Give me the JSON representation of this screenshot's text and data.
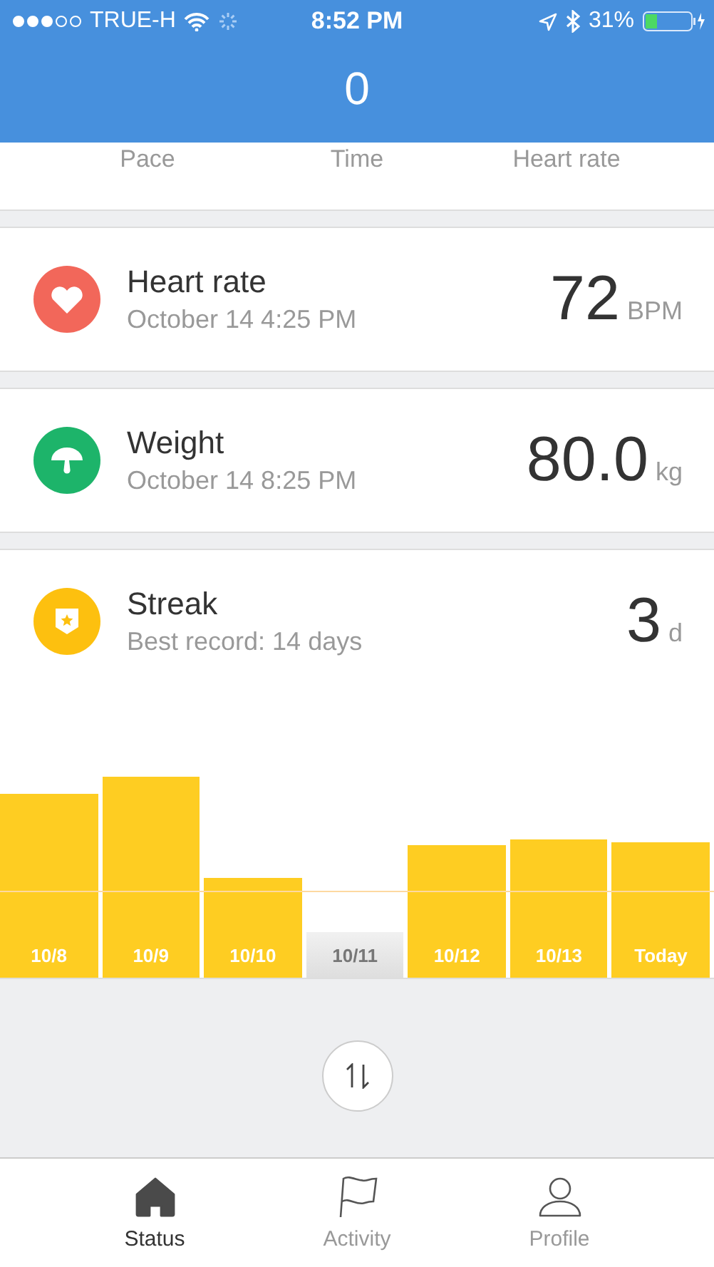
{
  "status_bar": {
    "carrier": "TRUE-H",
    "time": "8:52 PM",
    "battery": "31%"
  },
  "header": {
    "title": "0"
  },
  "summary_labels": [
    "Pace",
    "Time",
    "Heart rate"
  ],
  "cards": [
    {
      "kind": "heart",
      "title": "Heart rate",
      "subtitle": "October 14 4:25 PM",
      "value": "72",
      "unit": "BPM",
      "color": "#f2675a"
    },
    {
      "kind": "weight",
      "title": "Weight",
      "subtitle": "October 14 8:25 PM",
      "value": "80.0",
      "unit": "kg",
      "color": "#1db46a"
    },
    {
      "kind": "streak",
      "title": "Streak",
      "subtitle": "Best record: 14 days",
      "value": "3",
      "unit": "d",
      "color": "#fdc00f"
    }
  ],
  "streak_days": [
    {
      "label": "10/8",
      "done": true
    },
    {
      "label": "10/9",
      "done": true
    },
    {
      "label": "10/10",
      "done": true
    },
    {
      "label": "10/11",
      "done": false
    },
    {
      "label": "10/12",
      "done": true
    },
    {
      "label": "10/13",
      "done": true
    },
    {
      "label": "Today",
      "done": true
    }
  ],
  "tabs": [
    {
      "kind": "home",
      "label": "Status",
      "selected": true
    },
    {
      "kind": "flag",
      "label": "Activity",
      "selected": false
    },
    {
      "kind": "person",
      "label": "Profile",
      "selected": false
    }
  ]
}
